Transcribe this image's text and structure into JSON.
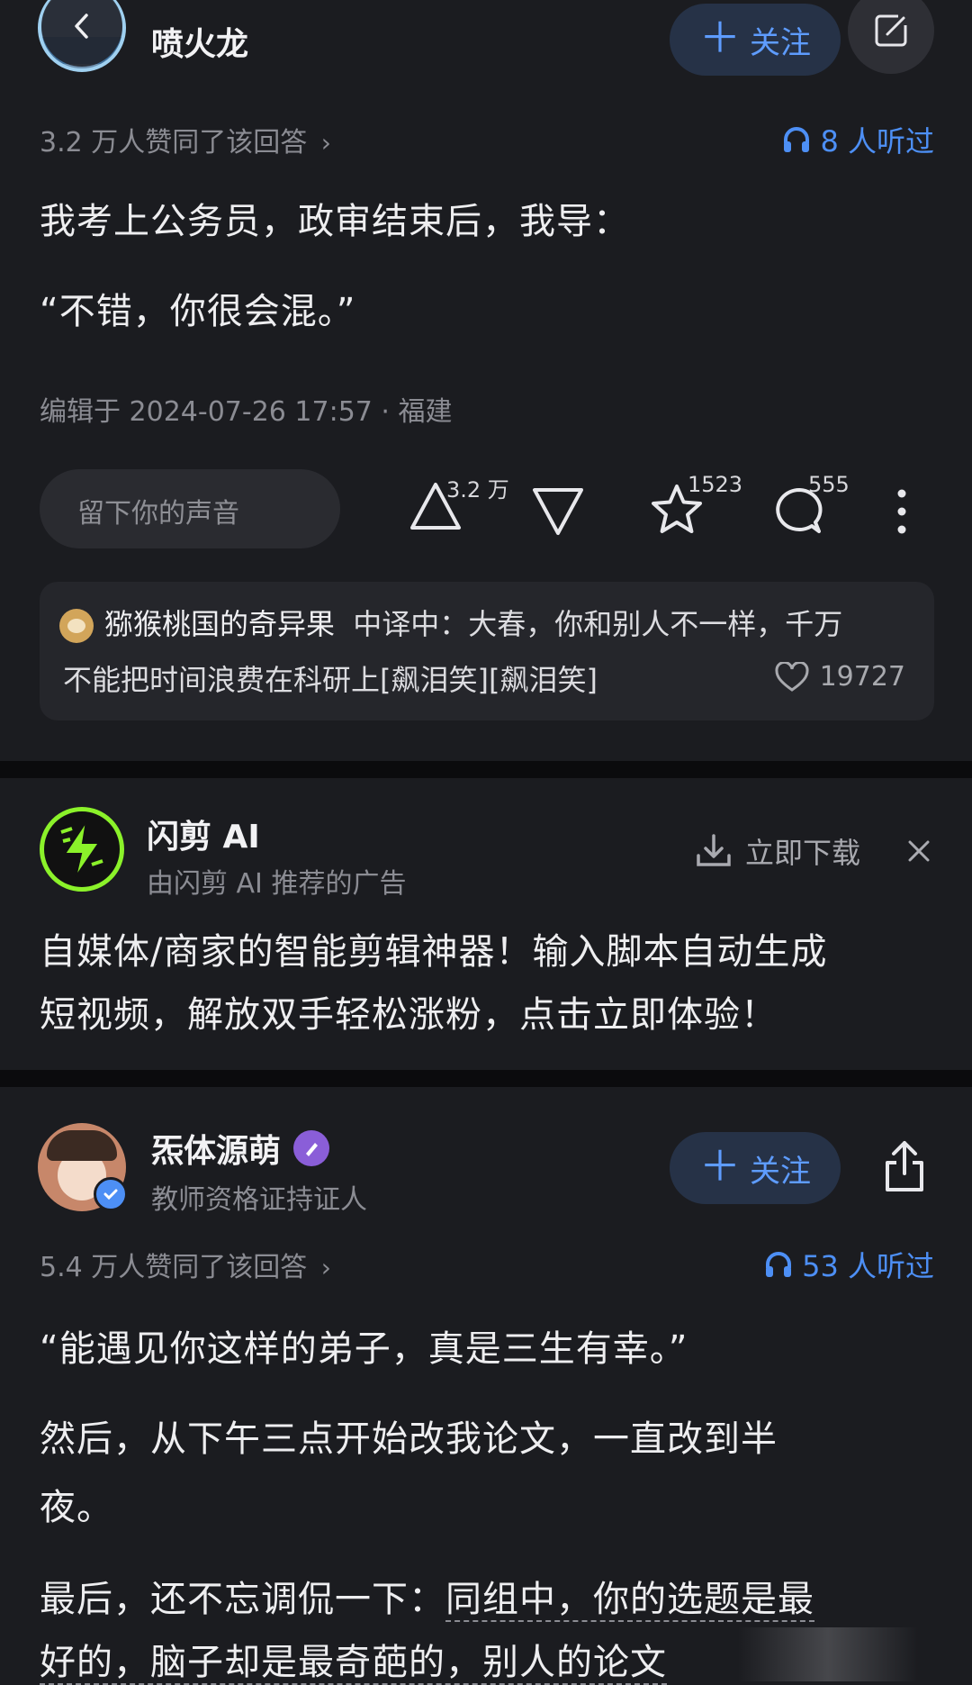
{
  "answer1": {
    "author": "喷火龙",
    "follow_label": "关注",
    "agree_text": "3.2 万人赞同了该回答",
    "listen_text": "8 人听过",
    "paragraphs": [
      "我考上公务员，政审结束后，我导：",
      "“不错，你很会混。”"
    ],
    "edited": "编辑于 2024-07-26 17:57 · 福建",
    "comment_placeholder": "留下你的声音",
    "upvote_count": "3.2 万",
    "star_count": "1523",
    "comment_count": "555",
    "top_comment": {
      "user": "猕猴桃国的奇异果",
      "text_line1": "中译中：大春，你和别人不一样，千万",
      "text_line2": "不能把时间浪费在科研上[飙泪笑][飙泪笑]",
      "likes": "19727"
    }
  },
  "ad": {
    "name": "闪剪 AI",
    "subtitle": "由闪剪 AI 推荐的广告",
    "download_label": "立即下载",
    "text_line1": "自媒体/商家的智能剪辑神器！输入脚本自动生成",
    "text_line2": "短视频，解放双手轻松涨粉，点击立即体验！",
    "brand_color": "#8bf22a"
  },
  "answer2": {
    "author": "炁体源萌",
    "bio": "教师资格证持证人",
    "follow_label": "关注",
    "agree_text": "5.4 万人赞同了该回答",
    "listen_text": "53 人听过",
    "paragraph1": "“能遇见你这样的弟子，真是三生有幸。”",
    "paragraph2_line1": "然后，从下午三点开始改我论文，一直改到半",
    "paragraph2_line2": "夜。",
    "paragraph3_line1_a": "最后，还不忘调侃一下：",
    "paragraph3_line1_b": "同组中，你的选题是最",
    "paragraph3_line2": "好的，脑子却是最奇葩的，别人的论文"
  },
  "colors": {
    "background": "#1b1c20",
    "accent": "#4d8ff5",
    "separator": "#0b0b0d"
  }
}
